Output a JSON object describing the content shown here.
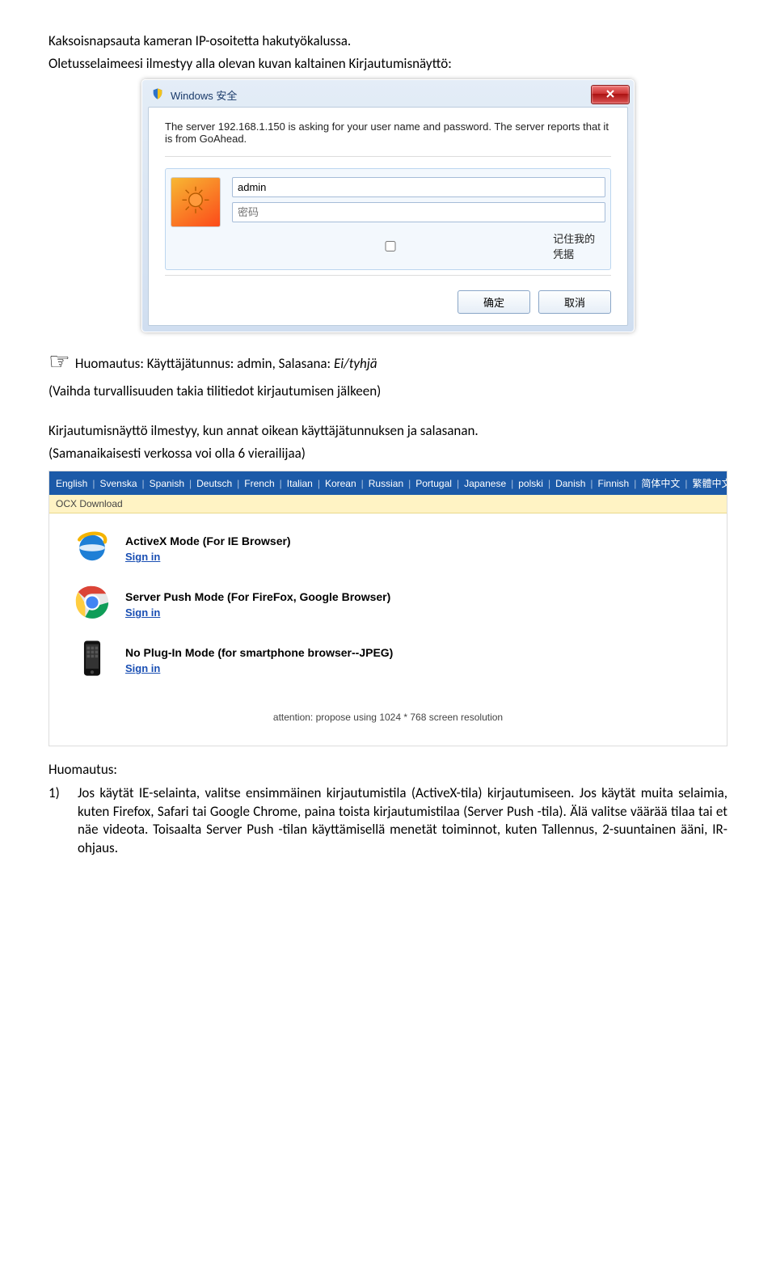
{
  "doc": {
    "line1": "Kaksoisnapsauta kameran IP-osoitetta hakutyökalussa.",
    "line2": "Oletusselaimeesi ilmestyy alla olevan kuvan kaltainen Kirjautumisnäyttö:"
  },
  "dialog": {
    "title": "Windows 安全",
    "msg": "The server 192.168.1.150 is asking for your user name and password. The server reports that it is from GoAhead.",
    "username_value": "admin",
    "password_placeholder": "密码",
    "remember_label": "记住我的凭据",
    "ok": "确定",
    "cancel": "取消"
  },
  "note1": {
    "prefix": "Huomautus: Käyttäjätunnus: admin, Salasana: ",
    "italic": "Ei/tyhjä"
  },
  "doc2": {
    "line3": "(Vaihda turvallisuuden takia tilitiedot kirjautumisen jälkeen)",
    "line4": "Kirjautumisnäyttö ilmestyy, kun annat oikean käyttäjätunnuksen ja salasanan.",
    "line5": "(Samanaikaisesti verkossa voi olla 6 vierailijaa)"
  },
  "langs": [
    "English",
    "Svenska",
    "Spanish",
    "Deutsch",
    "French",
    "Italian",
    "Korean",
    "Russian",
    "Portugal",
    "Japanese",
    "polski",
    "Danish",
    "Finnish",
    "简体中文",
    "繁體中文"
  ],
  "ocx": "OCX Download",
  "modes": {
    "activex": "ActiveX Mode (For IE Browser)",
    "serverpush": "Server Push Mode (For FireFox, Google Browser)",
    "noplugin": "No Plug-In Mode (for smartphone browser--JPEG)",
    "signin": "Sign in",
    "attention": "attention: propose using 1024 * 768 screen resolution"
  },
  "note2": {
    "heading": "Huomautus:",
    "num": "1)",
    "body": "Jos käytät IE-selainta, valitse ensimmäinen kirjautumistila (ActiveX-tila) kirjautumiseen. Jos käytät muita selaimia, kuten Firefox, Safari tai Google Chrome, paina toista kirjautumistilaa (Server Push -tila). Älä valitse väärää tilaa tai et näe videota. Toisaalta Server Push -tilan käyttämisellä menetät toiminnot, kuten Tallennus, 2-suuntainen ääni, IR-ohjaus."
  }
}
